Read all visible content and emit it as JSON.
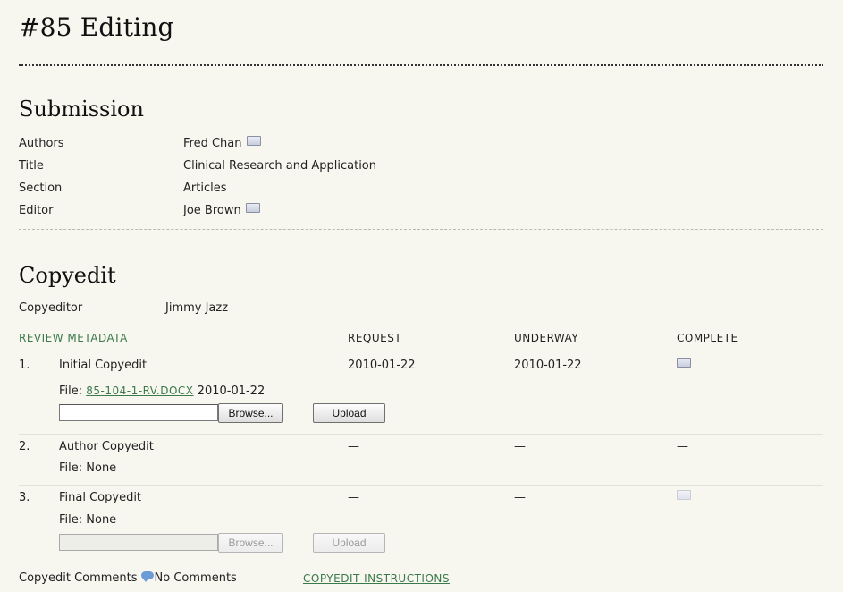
{
  "page": {
    "title": "#85 Editing"
  },
  "submission": {
    "heading": "Submission",
    "fields": [
      {
        "label": "Authors",
        "value": "Fred Chan",
        "has_email_icon": true
      },
      {
        "label": "Title",
        "value": "Clinical Research and Application",
        "has_email_icon": false
      },
      {
        "label": "Section",
        "value": "Articles",
        "has_email_icon": false
      },
      {
        "label": "Editor",
        "value": "Joe Brown",
        "has_email_icon": true
      }
    ]
  },
  "copyedit": {
    "heading": "Copyedit",
    "copyeditor_label": "Copyeditor",
    "copyeditor_name": "Jimmy Jazz",
    "review_metadata_link": "REVIEW METADATA",
    "columns": {
      "request": "REQUEST",
      "underway": "UNDERWAY",
      "complete": "COMPLETE"
    },
    "steps": [
      {
        "num": "1.",
        "name": "Initial Copyedit",
        "request": "2010-01-22",
        "underway": "2010-01-22",
        "complete_icon": "email-icon",
        "file_label": "File:",
        "file_link": "85-104-1-RV.DOCX",
        "file_date": "2010-01-22",
        "browse": "Browse...",
        "upload": "Upload",
        "upload_enabled": true
      },
      {
        "num": "2.",
        "name": "Author Copyedit",
        "request": "—",
        "underway": "—",
        "complete": "—",
        "file_text": "File: None"
      },
      {
        "num": "3.",
        "name": "Final Copyedit",
        "request": "—",
        "underway": "—",
        "complete_icon": "email-icon-disabled",
        "file_text": "File: None",
        "browse": "Browse...",
        "upload": "Upload",
        "upload_enabled": false
      }
    ],
    "comments_label": "Copyedit Comments",
    "comments_status": "No Comments",
    "instructions_link": "COPYEDIT INSTRUCTIONS"
  },
  "colors": {
    "background": "#f7f6ef",
    "link": "#3a7a4b",
    "comment_icon": "#6d9bd8"
  }
}
